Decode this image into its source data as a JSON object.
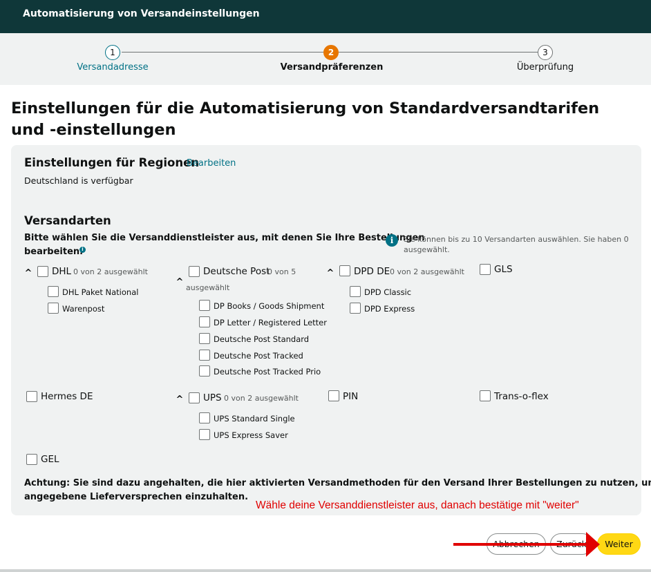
{
  "header": {
    "title": "Automatisierung von Versandeinstellungen"
  },
  "stepper": {
    "steps": [
      {
        "number": "1",
        "label": "Versandadresse"
      },
      {
        "number": "2",
        "label": "Versandpräferenzen"
      },
      {
        "number": "3",
        "label": "Überprüfung"
      }
    ]
  },
  "page": {
    "title": "Einstellungen für die Automatisierung von Standardversandtarifen und -einstellungen"
  },
  "regions": {
    "heading": "Einstellungen für Regionen",
    "edit_link": "Bearbeiten",
    "status": "Deutschland is verfügbar"
  },
  "shipping": {
    "heading": "Versandarten",
    "instruction": "Bitte wählen Sie die Versanddienstleister aus, mit denen Sie Ihre Bestellungen bearbeiten.",
    "instruction_line1": "Bitte wählen Sie die Versanddienstleister aus, mit denen Sie Ihre Bestellungen",
    "instruction_line2": "bearbeiten.",
    "info_line1": "Sie können bis zu 10 Versandarten auswählen. Sie haben 0",
    "info_line2": "ausgewählt.",
    "carriers": {
      "dhl": {
        "name": "DHL",
        "count": "0 von 2 ausgewählt",
        "options": [
          "DHL Paket National",
          "Warenpost"
        ]
      },
      "deutsche_post": {
        "name": "Deutsche Post",
        "count_a": "0 von 5",
        "count_b": "ausgewählt",
        "options": [
          "DP Books / Goods Shipment",
          "DP Letter / Registered Letter",
          "Deutsche Post Standard",
          "Deutsche Post Tracked",
          "Deutsche Post Tracked Prio"
        ]
      },
      "dpd": {
        "name": "DPD DE",
        "count": "0 von 2 ausgewählt",
        "options": [
          "DPD Classic",
          "DPD Express"
        ]
      },
      "gls": {
        "name": "GLS"
      },
      "hermes": {
        "name": "Hermes DE"
      },
      "ups": {
        "name": "UPS",
        "count": "0 von 2 ausgewählt",
        "options": [
          "UPS Standard Single",
          "UPS Express Saver"
        ]
      },
      "pin": {
        "name": "PIN"
      },
      "transoflex": {
        "name": "Trans-o-flex"
      },
      "gel": {
        "name": "GEL"
      }
    },
    "notice_line1": "Achtung: Sie sind dazu angehalten, die hier aktivierten Versandmethoden für den Versand Ihrer Bestellungen zu nutzen, um das",
    "notice_line2": "angegebene Lieferversprechen einzuhalten."
  },
  "annotation": {
    "text": "Wähle deine Versanddienstleister aus, danach bestätige mit \"weiter\""
  },
  "footer": {
    "cancel_label": "Abbrechen",
    "back_label": "Zurück",
    "next_label": "Weiter"
  },
  "colors": {
    "header_bg": "#0f3739",
    "step_active": "#e77600",
    "link": "#007185",
    "primary_button": "#ffd814",
    "annotation": "#e00000"
  }
}
